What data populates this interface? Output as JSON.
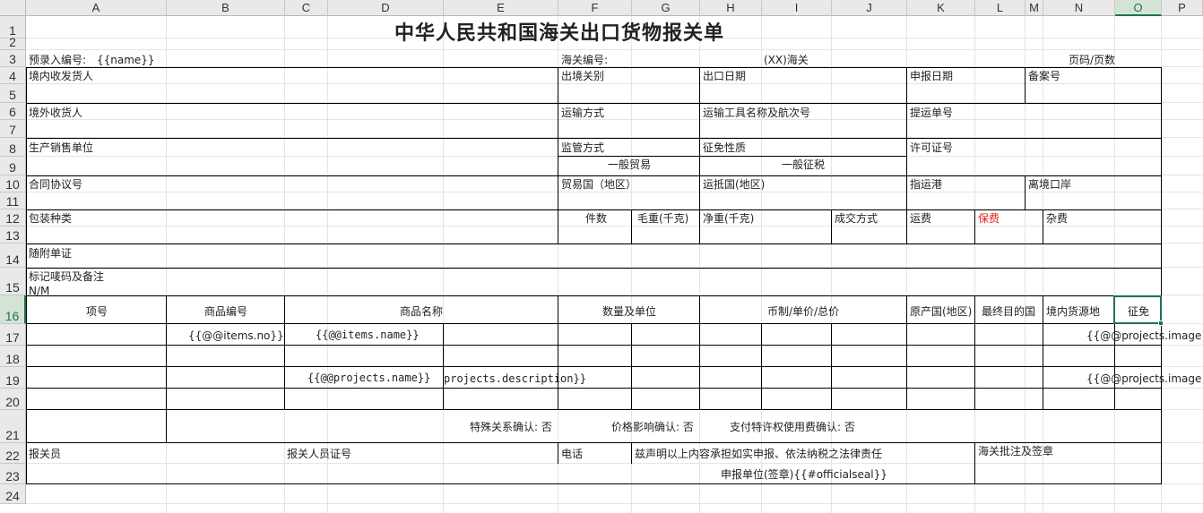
{
  "columns": [
    "A",
    "B",
    "C",
    "D",
    "E",
    "F",
    "G",
    "H",
    "I",
    "J",
    "K",
    "L",
    "M",
    "N",
    "O",
    "P"
  ],
  "rows": [
    "1",
    "2",
    "3",
    "4",
    "5",
    "6",
    "7",
    "8",
    "9",
    "10",
    "11",
    "12",
    "13",
    "14",
    "15",
    "16",
    "17",
    "18",
    "19",
    "20",
    "21",
    "22",
    "23",
    "24"
  ],
  "selection": {
    "column": "O",
    "row": "16"
  },
  "sheet": {
    "title": "中华人民共和国海关出口货物报关单",
    "pre_entry_label": "预录入编号:",
    "pre_entry_value": "{{name}}",
    "customs_no_label": "海关编号:",
    "customs_name": "(XX)海关",
    "page_label": "页码/页数",
    "domestic_shipper": "境内收发货人",
    "exit_port": "出境关别",
    "export_date": "出口日期",
    "declare_date": "申报日期",
    "record_no": "备案号",
    "overseas_consignee": "境外收货人",
    "transport_mode": "运输方式",
    "vessel_voyage": "运输工具名称及航次号",
    "bill_of_lading": "提运单号",
    "producer": "生产销售单位",
    "supervision_mode": "监管方式",
    "supervision_value": "一般贸易",
    "levy_nature": "征免性质",
    "levy_value": "一般征税",
    "license_no": "许可证号",
    "contract_no": "合同协议号",
    "trade_country": "贸易国（地区）",
    "destination_country": "运抵国(地区)",
    "port_of_destination": "指运港",
    "exit_port_bordered": "离境口岸",
    "package_type": "包装种类",
    "pieces": "件数",
    "gross_weight": "毛重(千克)",
    "net_weight": "净重(千克)",
    "deal_mode": "成交方式",
    "freight": "运费",
    "insurance": "保费",
    "misc_fee": "杂费",
    "documents": "随附单证",
    "marks_remarks": "标记唛码及备注",
    "marks_value": "N/M",
    "item_no": "项号",
    "goods_code": "商品编号",
    "goods_name": "商品名称",
    "qty_unit": "数量及单位",
    "currency_price": "币制/单价/总价",
    "origin_country": "原产国(地区)",
    "final_destination": "最终目的国",
    "domestic_source": "境内货源地",
    "levy_exempt": "征免",
    "items_no": "{{@@items.no}}",
    "items_name": "{{@@items.name}}",
    "projects_image_1": "{{@@projects.image}}",
    "projects_name": "{{@@projects.name}}",
    "projects_description": "projects.description}}",
    "projects_image_2": "{{@@projects.image}}",
    "special_relation": "特殊关系确认:  否",
    "price_influence": "价格影响确认:  否",
    "royalty": "支付特许权使用费确认:  否",
    "declarant": "报关员",
    "declarant_cert": "报关人员证号",
    "phone": "电话",
    "statement": "兹声明以上内容承担如实申报、依法纳税之法律责任",
    "customs_approval": "海关批注及签章",
    "declaring_unit": "申报单位(签章){{#officialseal}}"
  }
}
